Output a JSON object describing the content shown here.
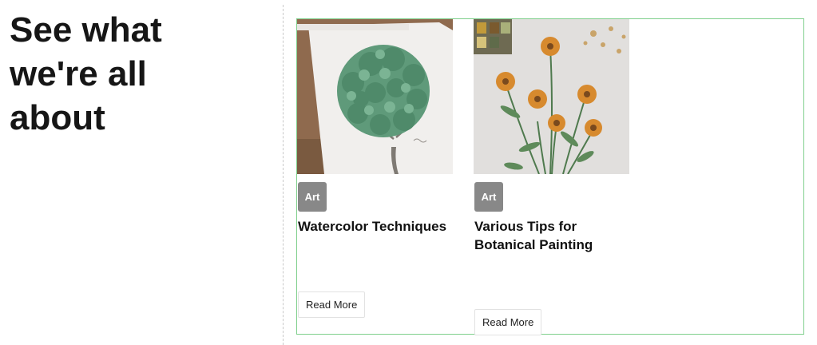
{
  "hero": {
    "heading": "See what we're all about"
  },
  "posts": [
    {
      "category": "Art",
      "title": "Watercolor Techniques",
      "button_label": "Read More",
      "image": "watercolor-tree-painting"
    },
    {
      "category": "Art",
      "title": "Various Tips for Botanical Painting",
      "button_label": "Read More",
      "image": "botanical-flowers-painting"
    }
  ],
  "colors": {
    "grid_border": "#7fcf8c",
    "badge_bg": "#888888",
    "badge_text": "#ffffff",
    "divider": "#c9c9c9"
  }
}
